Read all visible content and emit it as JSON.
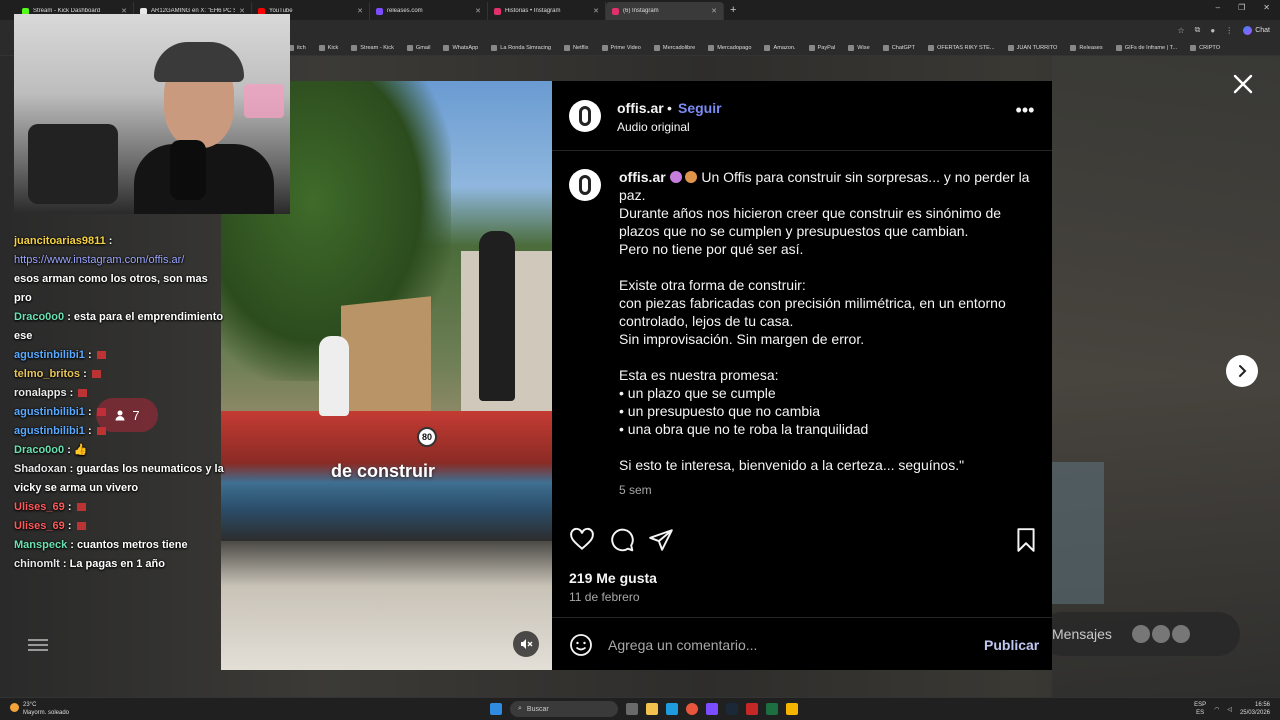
{
  "browser": {
    "tabs": [
      {
        "title": "Stream - Kick Dashboard",
        "color": "#53fc18",
        "active": false
      },
      {
        "title": "AR12GAMING en X: \"EH6 PC SPEC",
        "color": "#e7e7e7",
        "active": false
      },
      {
        "title": "YouTube",
        "color": "#ff0000",
        "active": false
      },
      {
        "title": "releases.com",
        "color": "#7c4dff",
        "active": false
      },
      {
        "title": "Historias • Instagram",
        "color": "#e1306c",
        "active": false
      },
      {
        "title": "(6) Instagram",
        "color": "#e1306c",
        "active": true
      }
    ],
    "new_tab": "+",
    "window_controls": [
      "–",
      "❐",
      "✕"
    ],
    "chat_label": "Chat",
    "bookmarks": [
      "itch",
      "Kick",
      "Stream - Kick",
      "Gmail",
      "WhatsApp",
      "La Ronda Simracing",
      "Netflix",
      "Prime Video",
      "Mercadolibre",
      "Mercadopago",
      "Amazon.",
      "PayPal",
      "Wise",
      "ChatGPT",
      "OFERTAS RIKY STE...",
      "JUAN TURRITO",
      "Releases",
      "GIFs de Inframe | T...",
      "CRIPTO"
    ]
  },
  "post": {
    "username": "offis.ar",
    "dot": "•",
    "follow_label": "Seguir",
    "audio": "Audio original",
    "more": "•••",
    "caption_user": "offis.ar",
    "caption_lines": [
      "Un Offis para construir sin sorpresas... y no perder la paz.",
      "Durante años nos hicieron creer que construir es sinónimo de plazos que no se cumplen y presupuestos que cambian.",
      "Pero no tiene por qué ser así.",
      "",
      "Existe otra forma de construir:",
      "con piezas fabricadas con precisión milimétrica, en un entorno controlado, lejos de tu casa.",
      "Sin improvisación. Sin margen de error.",
      "",
      "Esta es nuestra promesa:",
      "• un plazo que se cumple",
      "• un presupuesto que no cambia",
      "• una obra que no te roba la tranquilidad",
      "",
      "Si esto te interesa, bienvenido a la certeza... seguínos.\""
    ],
    "time_ago": "5 sem",
    "likes": "219 Me gusta",
    "date": "11 de febrero",
    "comment_placeholder": "Agrega un comentario...",
    "publish_label": "Publicar",
    "video_caption": "de construir",
    "truck_sign": "80"
  },
  "background": {
    "messages_label": "Mensajes"
  },
  "stream": {
    "viewers": "7",
    "chat": [
      {
        "user": "juancitoarias9811",
        "user_color": "#f5d142",
        "text": "",
        "link": "https://www.instagram.com/offis.ar/"
      },
      {
        "user": "",
        "user_color": "#ffffff",
        "text": "esos arman como los otros, son mas pro"
      },
      {
        "user": "Draco0o0",
        "user_color": "#6be0b0",
        "text": "esta para el emprendimiento ese"
      },
      {
        "user": "agustinbilibi1",
        "user_color": "#5aa9ff",
        "text": "",
        "emote": true
      },
      {
        "user": "telmo_britos",
        "user_color": "#e8c45a",
        "text": "",
        "emote": true
      },
      {
        "user": "ronalapps",
        "user_color": "#e8e8e8",
        "text": "",
        "emote": true
      },
      {
        "user": "agustinbilibi1",
        "user_color": "#5aa9ff",
        "text": "",
        "emote": true
      },
      {
        "user": "agustinbilibi1",
        "user_color": "#5aa9ff",
        "text": "",
        "emote": true
      },
      {
        "user": "Draco0o0",
        "user_color": "#6be0b0",
        "text": "👍"
      },
      {
        "user": "Shadoxan",
        "user_color": "#e8e8e8",
        "text": "guardas los neumaticos y la vicky se arma un vivero"
      },
      {
        "user": "Ulises_69",
        "user_color": "#ff5a5a",
        "text": "",
        "emote": true
      },
      {
        "user": "Ulises_69",
        "user_color": "#ff5a5a",
        "text": "",
        "emote": true
      },
      {
        "user": "Manspeck",
        "user_color": "#6be0b0",
        "text": "cuantos metros tiene"
      },
      {
        "user": "chinomlt",
        "user_color": "#e8e8e8",
        "text": "La pagas en 1 año"
      }
    ]
  },
  "taskbar": {
    "weather_temp": "23°C",
    "weather_desc": "Mayorm. soleado",
    "search": "Buscar",
    "lang_top": "ESP",
    "lang_bottom": "ES",
    "time": "16:56",
    "date": "25/03/2026"
  },
  "colors": {
    "accent_follow": "#7b8cf5",
    "panel_bg": "#000000",
    "publish": "#bfc6f2"
  }
}
